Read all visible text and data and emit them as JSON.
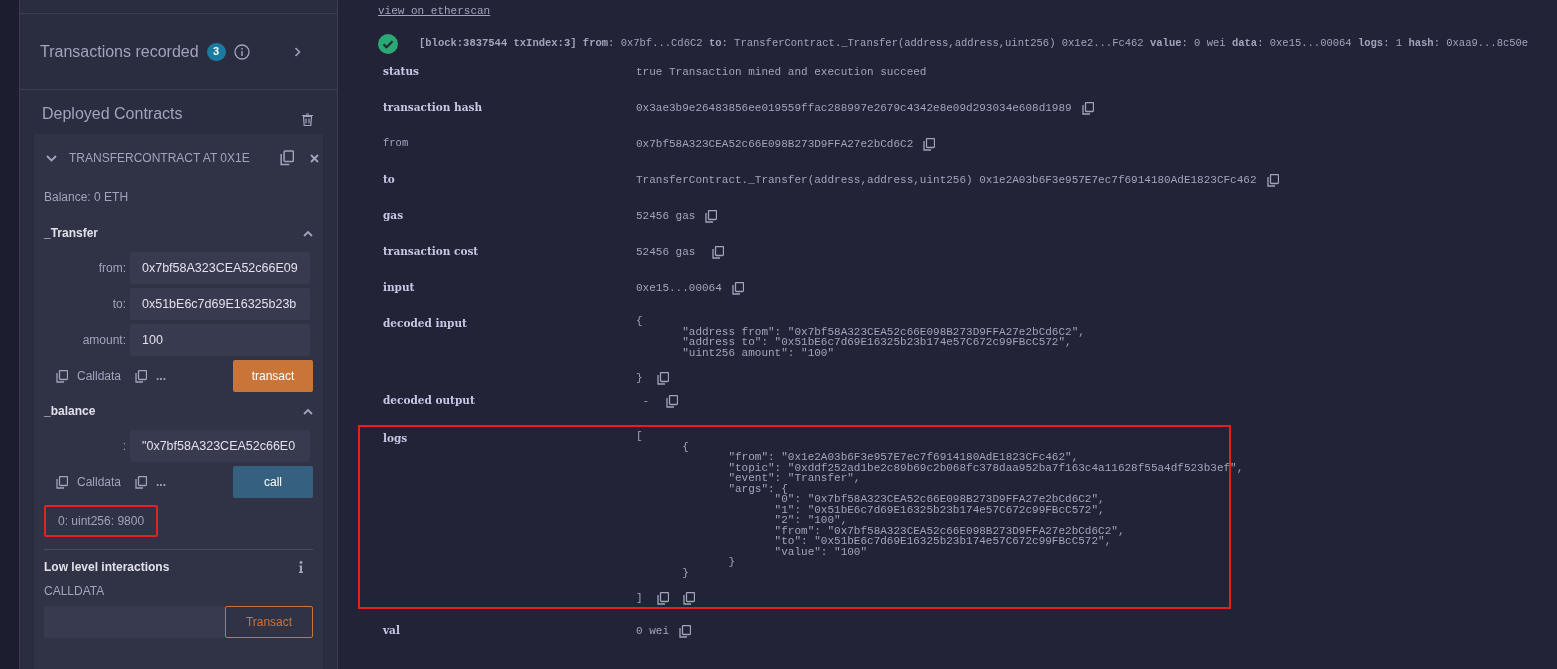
{
  "sidebar": {
    "transactions_recorded": {
      "label": "Transactions recorded",
      "count": "3"
    },
    "deployed_title": "Deployed Contracts",
    "contract": {
      "title": "TRANSFERCONTRACT AT 0X1E",
      "expanded": true,
      "balance": "Balance: 0 ETH",
      "functions": [
        {
          "name": "_Transfer",
          "kind": "transact",
          "inputs": [
            {
              "label": "from:",
              "value": "0x7bf58A323CEA52c66E09"
            },
            {
              "label": "to:",
              "value": "0x51bE6c7d69E16325b23b"
            },
            {
              "label": "amount:",
              "value": "100"
            }
          ],
          "calldata": "Calldata",
          "more": "...",
          "button": "transact"
        },
        {
          "name": "_balance",
          "kind": "call",
          "inputs": [
            {
              "label": ":",
              "value": "\"0x7bf58A323CEA52c66E0"
            }
          ],
          "calldata": "Calldata",
          "more": "...",
          "button": "call",
          "result": {
            "text": "0: uint256: 9800",
            "highlighted": true
          }
        }
      ]
    },
    "low_level": {
      "title": "Low level interactions",
      "calldata_label": "CALLDATA",
      "button": "Transact"
    }
  },
  "main": {
    "link": "view on etherscan",
    "tx_header": "**[block:3837544 txIndex:3]** **from**: 0x7bf...Cd6C2 **to**: TransferContract._Transfer(address,address,uint256) 0x1e2...Fc462 **value**: 0 wei **data**: 0xe15...00064 **logs**: 1 **hash**: 0xaa9...8c50e",
    "rows": [
      {
        "label": "status",
        "bold": true,
        "value": [
          "true Transaction mined and execution succeed"
        ]
      },
      {
        "label": "transaction hash",
        "bold": true,
        "value": [
          "0x3ae3b9e26483856ee019559ffac288997e2679c4342e8e09d293034e608d1989"
        ],
        "copy": true
      },
      {
        "label": "from",
        "bold": false,
        "value": [
          "0x7bf58A323CEA52c66E098B273D9FFA27e2bCd6C2"
        ],
        "copy": true
      },
      {
        "label": "to",
        "bold": true,
        "value": [
          "TransferContract._Transfer(address,address,uint256) 0x1e2A03b6F3e957E7ec7f6914180AdE1823CFc462"
        ],
        "copy": true
      },
      {
        "label": "gas",
        "bold": true,
        "value": [
          "52456 gas"
        ],
        "copy": true
      },
      {
        "label": "transaction cost",
        "bold": true,
        "value": [
          "52456 gas "
        ],
        "copy": true
      },
      {
        "label": "input",
        "bold": true,
        "value": [
          "0xe15...00064"
        ],
        "copy": true
      },
      {
        "label": "decoded input",
        "bold": true,
        "value": [
          "{",
          "       \"address from\": \"0x7bf58A323CEA52c66E098B273D9FFA27e2bCd6C2\",",
          "       \"address to\": \"0x51bE6c7d69E16325b23b174e57C672c99FBcC572\",",
          "       \"uint256 amount\": \"100\"",
          "}"
        ],
        "copy": true
      },
      {
        "label": "decoded output",
        "bold": true,
        "value": [
          " - "
        ],
        "copy": true
      },
      {
        "label": "logs",
        "bold": true,
        "highlighted": true,
        "value": [
          "[",
          "       {",
          "              \"from\": \"0x1e2A03b6F3e957E7ec7f6914180AdE1823CFc462\",",
          "              \"topic\": \"0xddf252ad1be2c89b69c2b068fc378daa952ba7f163c4a11628f55a4df523b3ef\",",
          "              \"event\": \"Transfer\",",
          "              \"args\": {",
          "                     \"0\": \"0x7bf58A323CEA52c66E098B273D9FFA27e2bCd6C2\",",
          "                     \"1\": \"0x51bE6c7d69E16325b23b174e57C672c99FBcC572\",",
          "                     \"2\": \"100\",",
          "                     \"from\": \"0x7bf58A323CEA52c66E098B273D9FFA27e2bCd6C2\",",
          "                     \"to\": \"0x51bE6c7d69E16325b23b174e57C672c99FBcC572\",",
          "                     \"value\": \"100\"",
          "              }",
          "       }",
          "]"
        ],
        "copy": true,
        "extra_copy": true
      },
      {
        "label": "val",
        "bold": true,
        "value": [
          "0 wei"
        ],
        "copy": true
      }
    ]
  }
}
